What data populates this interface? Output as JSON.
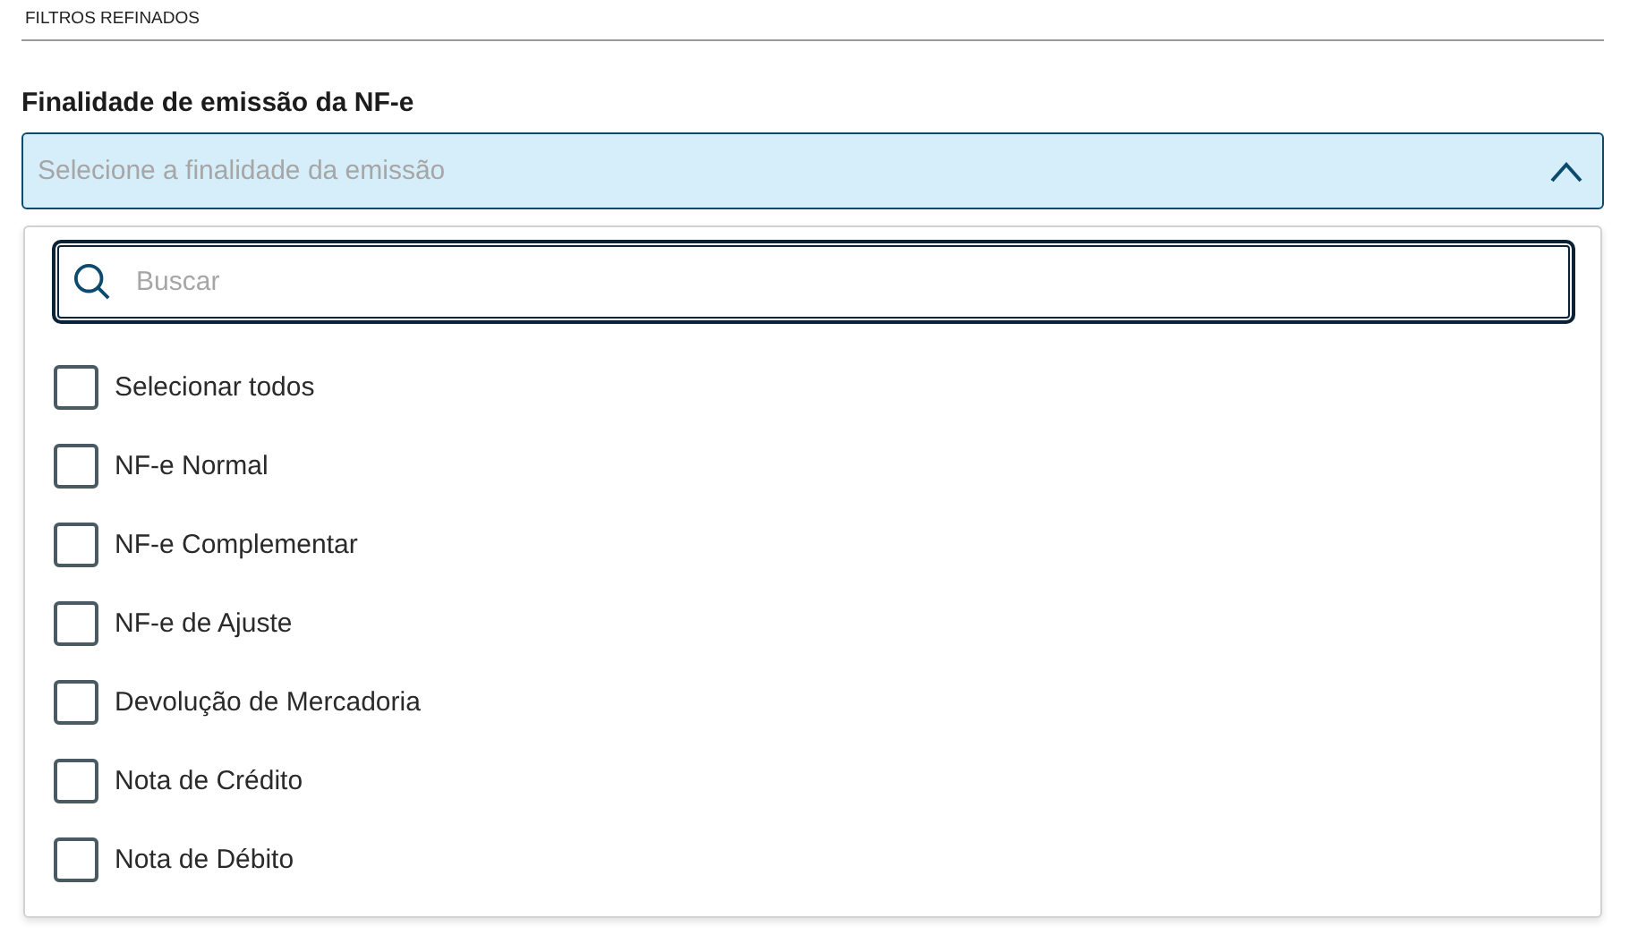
{
  "section_title": "FILTROS REFINADOS",
  "field": {
    "label": "Finalidade de emissão da NF-e",
    "placeholder": "Selecione a finalidade da emissão",
    "expanded": true
  },
  "dropdown": {
    "search": {
      "placeholder": "Buscar"
    },
    "options": [
      {
        "label": "Selecionar todos",
        "checked": false
      },
      {
        "label": "NF-e Normal",
        "checked": false
      },
      {
        "label": "NF-e Complementar",
        "checked": false
      },
      {
        "label": "NF-e de Ajuste",
        "checked": false
      },
      {
        "label": "Devolução de Mercadoria",
        "checked": false
      },
      {
        "label": "Nota de Crédito",
        "checked": false
      },
      {
        "label": "Nota de Débito",
        "checked": false
      }
    ]
  }
}
